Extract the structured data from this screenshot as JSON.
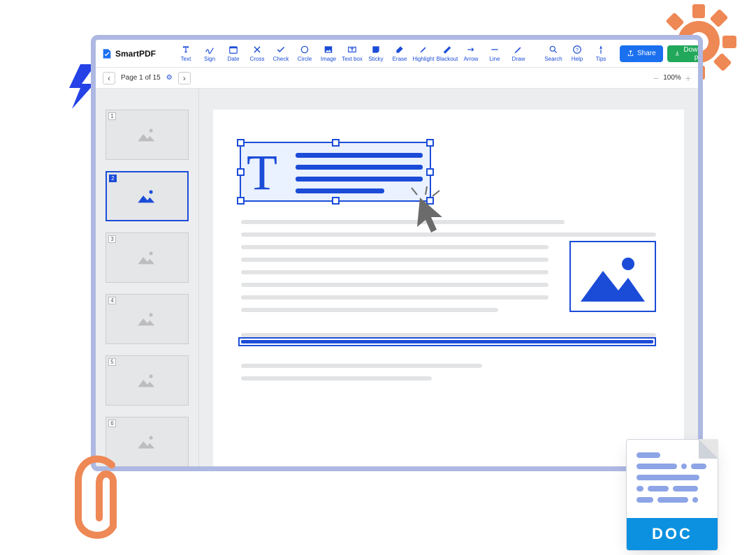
{
  "brand": "SmartPDF",
  "tools": [
    "Text",
    "Sign",
    "Date",
    "Cross",
    "Check",
    "Circle",
    "Image",
    "Text box",
    "Sticky",
    "Erase",
    "Highlight",
    "Blackout",
    "Arrow",
    "Line",
    "Draw"
  ],
  "help_tools": [
    "Search",
    "Help",
    "Tips"
  ],
  "buttons": {
    "share": "Share",
    "download": "Download pdf"
  },
  "page_info": {
    "label": "Page 1 of 15"
  },
  "zoom": {
    "value": "100%"
  },
  "thumbs": [
    "1",
    "2",
    "3",
    "4",
    "5",
    "6"
  ],
  "active_thumb_index": 1,
  "doc_badge": "DOC"
}
